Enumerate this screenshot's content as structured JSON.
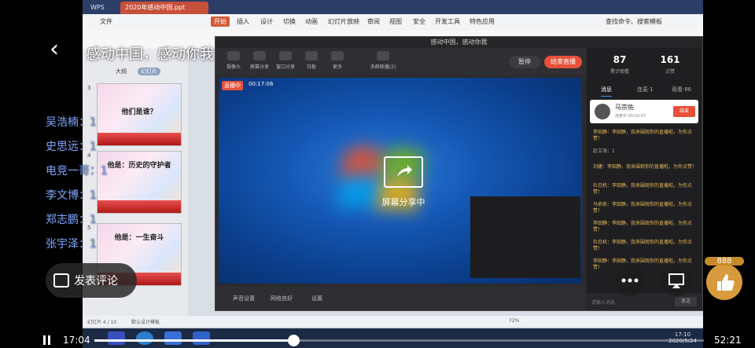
{
  "player": {
    "title": "感动中国，感动你我",
    "current_time": "17:04",
    "total_time": "52:21",
    "progress": 0.326,
    "comment_label": "发表评论",
    "like_count": "888"
  },
  "roster": [
    {
      "name": "吴浩楠",
      "count": "1"
    },
    {
      "name": "史思远",
      "count": "1"
    },
    {
      "name": "电竞一哥",
      "count": "1"
    },
    {
      "name": "李文博",
      "count": "1"
    },
    {
      "name": "郑志鹏",
      "count": "1"
    },
    {
      "name": "张宇泽",
      "count": "1"
    }
  ],
  "wps": {
    "app_tab": "WPS",
    "doc_tab": "2020年感动中国.ppt",
    "ribbon": [
      "文件",
      "开始",
      "插入",
      "设计",
      "切换",
      "动画",
      "幻灯片放映",
      "审阅",
      "视图",
      "安全",
      "开发工具",
      "特色应用"
    ],
    "search": "查找命令、搜索模板",
    "panel_tabs": [
      "大纲",
      "幻灯片"
    ],
    "slides": [
      {
        "num": "3",
        "title": "他们是谁？"
      },
      {
        "num": "4",
        "title": "他是：历史的守护者"
      },
      {
        "num": "5",
        "title": "他是：一生奋斗"
      }
    ],
    "status_left": "幻灯片 4 / 10",
    "status_theme": "默认设计模板",
    "zoom": "72%"
  },
  "live": {
    "window_title": "感动中国，感动你我",
    "tools": [
      "摄像头",
      "屏幕分享",
      "窗口分享",
      "白板",
      "更多",
      "多群联播(2)"
    ],
    "pause_label": "暂停",
    "end_label": "结束直播",
    "badge": "直播中",
    "timer": "00:17:06",
    "share_text": "屏幕分享中",
    "bottom": [
      "声音设置",
      "网络良好",
      "设置"
    ],
    "stats": [
      {
        "value": "87",
        "label": "累计观看"
      },
      {
        "value": "161",
        "label": "点赞"
      }
    ],
    "tabs": [
      "消息",
      "连麦·1",
      "观看·86"
    ],
    "user_card": {
      "name": "马宗佑",
      "status": "连麦中 00:00:07",
      "button": "结束"
    },
    "messages": [
      {
        "text": "李田静：李田静，我来围观你的直播啦，为你点赞！",
        "type": "chat"
      },
      {
        "text": "赵立海：1",
        "type": "sys"
      },
      {
        "text": "刘婕：李田静，我来围观你的直播啦，为你点赞！",
        "type": "chat"
      },
      {
        "text": "杜忍机：李田静，我来围观你的直播啦，为你点赞！",
        "type": "chat"
      },
      {
        "text": "马依依：李田静，我来围观你的直播啦，为你点赞！",
        "type": "chat"
      },
      {
        "text": "李田静：李田静，我来围观你的直播啦，为你点赞！",
        "type": "chat"
      },
      {
        "text": "杜忍机：李田静，我来围观你的直播啦，为你点赞！",
        "type": "chat"
      },
      {
        "text": "李田静：李田静，我来围观你的直播啦，为你点赞！",
        "type": "chat"
      }
    ],
    "input_placeholder": "请输入消息",
    "send_label": "发送"
  },
  "taskbar": {
    "time": "17:10",
    "date": "2020/5/24"
  }
}
